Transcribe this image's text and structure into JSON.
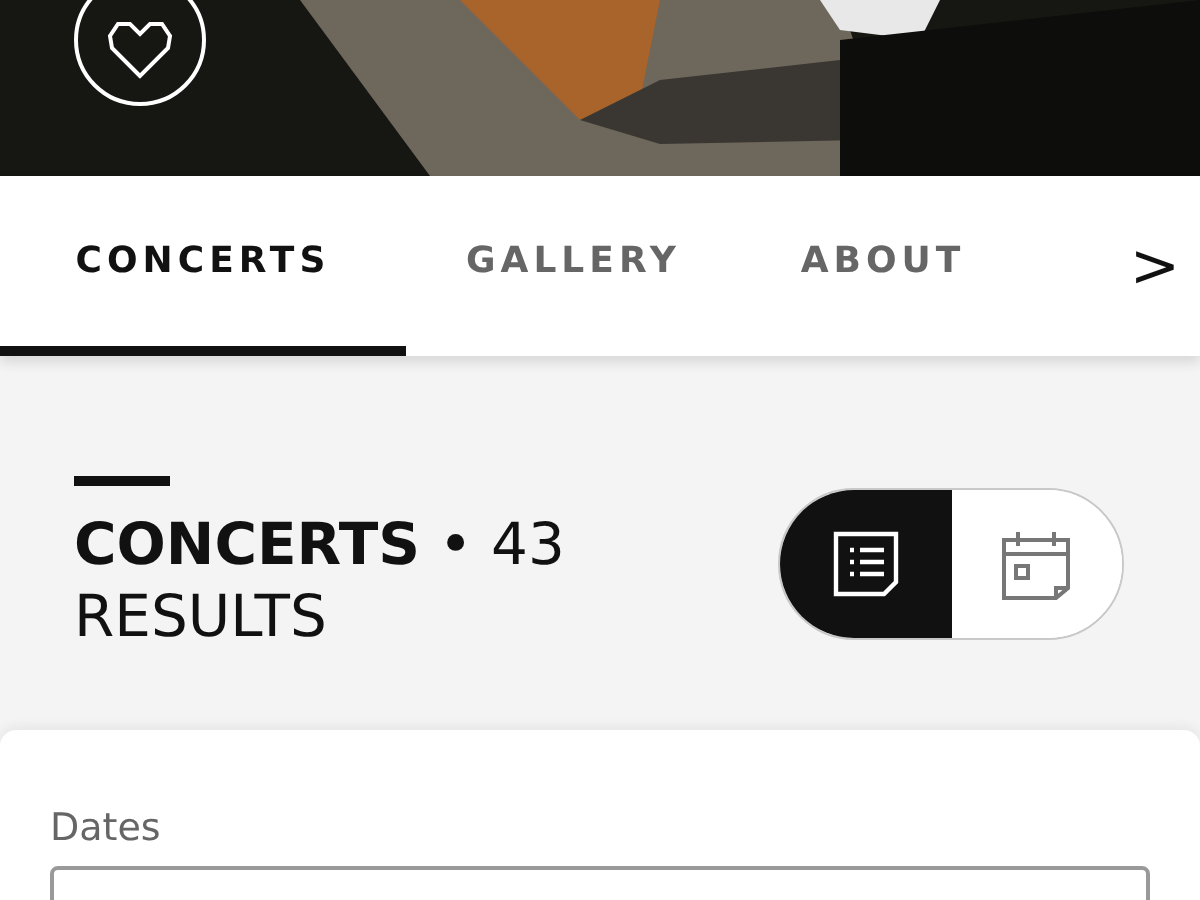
{
  "tabs": [
    {
      "label": "CONCERTS",
      "selected": true
    },
    {
      "label": "GALLERY",
      "selected": false
    },
    {
      "label": "ABOUT",
      "selected": false
    }
  ],
  "tabs_next": ">",
  "heading": "**CONCERTS** • 43 RESULTS",
  "views": [
    {
      "kind": "list",
      "selected": true
    },
    {
      "kind": "calendar",
      "selected": false
    }
  ],
  "filters": {
    "dates_label": "Dates"
  }
}
